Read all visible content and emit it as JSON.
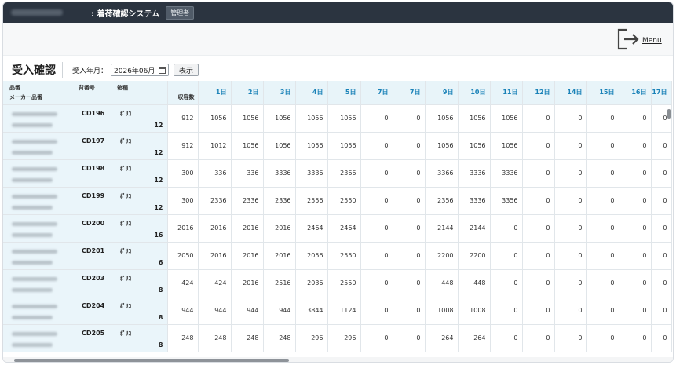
{
  "header": {
    "system_title": ": 着荷確認システム",
    "role_badge": "管理者"
  },
  "menu": {
    "label": "Menu"
  },
  "page": {
    "title": "受入確認",
    "year_month_label": "受入年月：",
    "year_month_value": "2026年06月",
    "show_button": "表示"
  },
  "table": {
    "headers": {
      "item_no": "品番",
      "maker_item_no": "メーカー品番",
      "back_no": "背番号",
      "box_type": "箱種",
      "capacity": "収容数"
    },
    "day_headers": [
      "1日",
      "2日",
      "3日",
      "4日",
      "5日",
      "7日",
      "7日",
      "9日",
      "10日",
      "11日",
      "12日",
      "14日",
      "15日",
      "16日",
      "17日"
    ],
    "rows": [
      {
        "part": "CD196",
        "box": "ﾎﾟﾘｺ",
        "qty": "12",
        "capacity": "912",
        "days": [
          "1056",
          "1056",
          "1056",
          "1056",
          "1056",
          "0",
          "0",
          "1056",
          "1056",
          "1056",
          "0",
          "0",
          "0",
          "0",
          "0"
        ]
      },
      {
        "part": "CD197",
        "box": "ﾎﾟﾘｺ",
        "qty": "12",
        "capacity": "912",
        "days": [
          "1012",
          "1056",
          "1056",
          "1056",
          "1056",
          "0",
          "0",
          "1056",
          "1056",
          "1056",
          "0",
          "0",
          "0",
          "0",
          "0"
        ]
      },
      {
        "part": "CD198",
        "box": "ﾎﾟﾘｺ",
        "qty": "12",
        "capacity": "300",
        "days": [
          "336",
          "336",
          "3336",
          "3336",
          "2366",
          "0",
          "0",
          "3366",
          "3336",
          "3336",
          "0",
          "0",
          "0",
          "0",
          "0"
        ]
      },
      {
        "part": "CD199",
        "box": "ﾎﾟﾘｺ",
        "qty": "12",
        "capacity": "300",
        "days": [
          "2336",
          "2336",
          "2336",
          "2556",
          "2550",
          "0",
          "0",
          "2356",
          "3336",
          "3356",
          "0",
          "0",
          "0",
          "0",
          "0"
        ]
      },
      {
        "part": "CD200",
        "box": "ﾎﾟﾘｺ",
        "qty": "16",
        "capacity": "2016",
        "days": [
          "2016",
          "2016",
          "2016",
          "2464",
          "2464",
          "0",
          "0",
          "2144",
          "2144",
          "0",
          "0",
          "0",
          "0",
          "0",
          "0"
        ]
      },
      {
        "part": "CD201",
        "box": "ﾎﾟﾘｺ",
        "qty": "6",
        "capacity": "2050",
        "days": [
          "2016",
          "2016",
          "2016",
          "2056",
          "2550",
          "0",
          "0",
          "2200",
          "2200",
          "0",
          "0",
          "0",
          "0",
          "0",
          "0"
        ]
      },
      {
        "part": "CD203",
        "box": "ﾎﾟﾘｺ",
        "qty": "8",
        "capacity": "424",
        "days": [
          "424",
          "2016",
          "2516",
          "2036",
          "2550",
          "0",
          "0",
          "448",
          "448",
          "0",
          "0",
          "0",
          "0",
          "0",
          "0"
        ]
      },
      {
        "part": "CD204",
        "box": "ﾎﾟﾘｺ",
        "qty": "8",
        "capacity": "944",
        "days": [
          "944",
          "944",
          "944",
          "3844",
          "1124",
          "0",
          "0",
          "1008",
          "1008",
          "0",
          "0",
          "0",
          "0",
          "0",
          "0"
        ]
      },
      {
        "part": "CD205",
        "box": "ﾎﾟﾘｺ",
        "qty": "8",
        "capacity": "248",
        "days": [
          "248",
          "248",
          "248",
          "296",
          "296",
          "0",
          "0",
          "264",
          "264",
          "0",
          "0",
          "0",
          "0",
          "0",
          "0"
        ]
      }
    ]
  }
}
